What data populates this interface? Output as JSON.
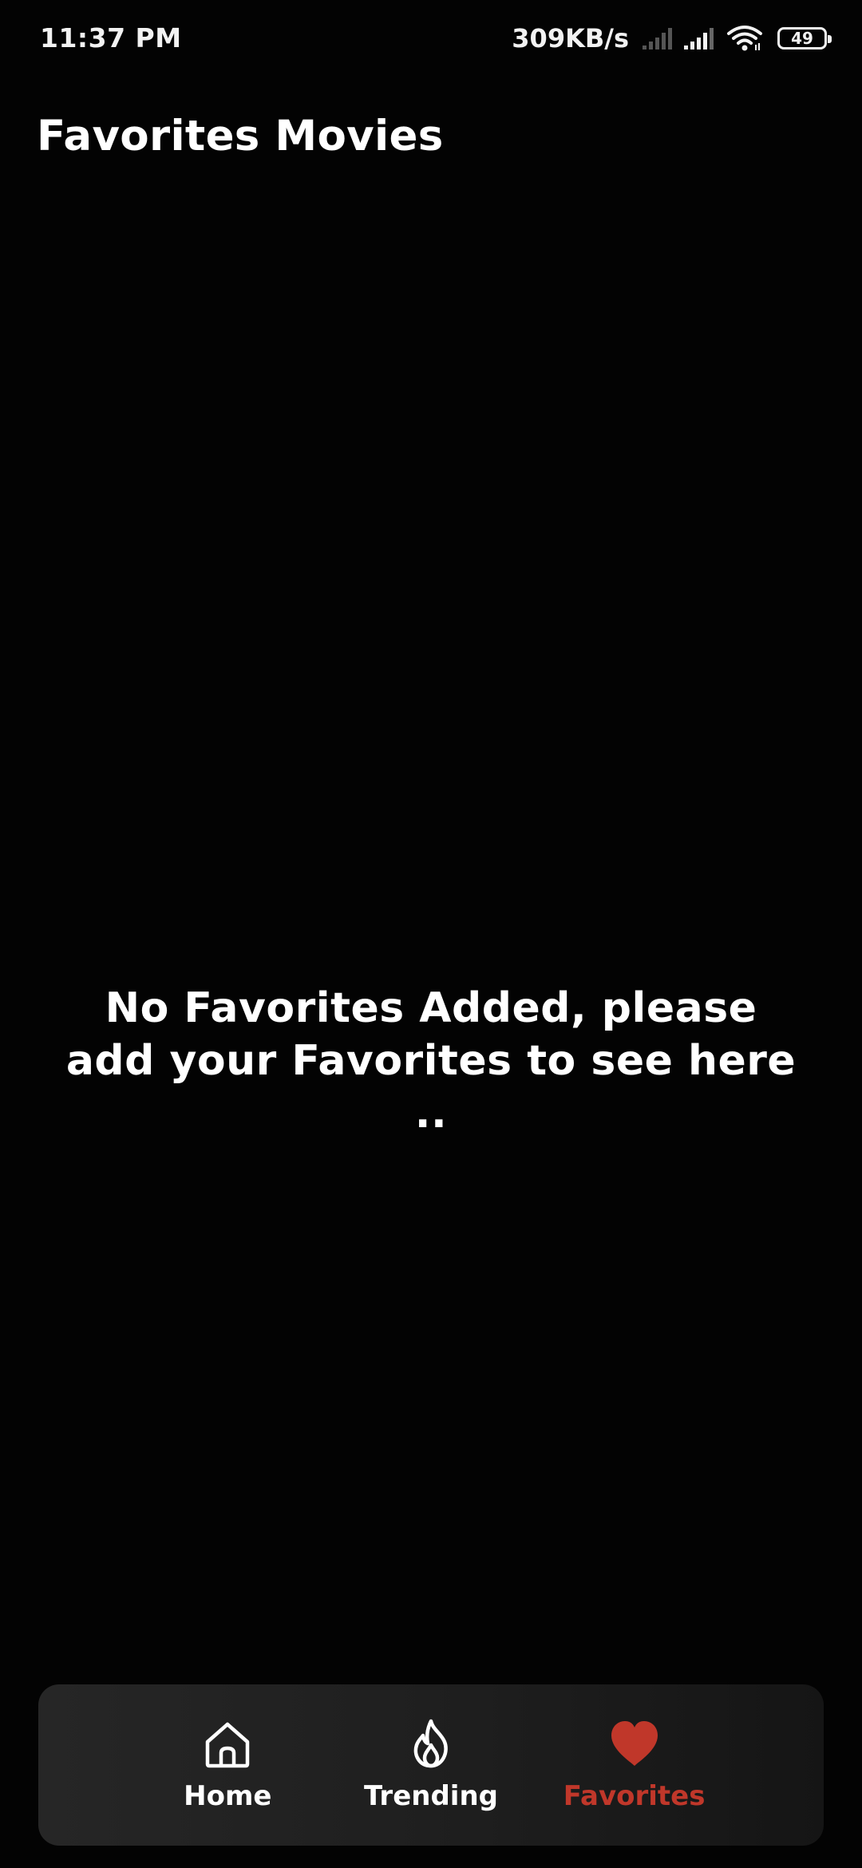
{
  "status_bar": {
    "time": "11:37 PM",
    "net_speed": "309KB/s",
    "battery_level": "49",
    "icons": [
      "signal-weak-icon",
      "signal-icon",
      "wifi-icon",
      "battery-icon"
    ]
  },
  "header": {
    "title": "Favorites Movies"
  },
  "empty_state": {
    "message": "No Favorites Added, please add your Favorites to see here .."
  },
  "bottom_nav": {
    "active_color": "#c0372a",
    "items": [
      {
        "label": "Home",
        "icon": "home-icon",
        "active": false
      },
      {
        "label": "Trending",
        "icon": "flame-icon",
        "active": false
      },
      {
        "label": "Favorites",
        "icon": "heart-icon",
        "active": true
      }
    ]
  }
}
